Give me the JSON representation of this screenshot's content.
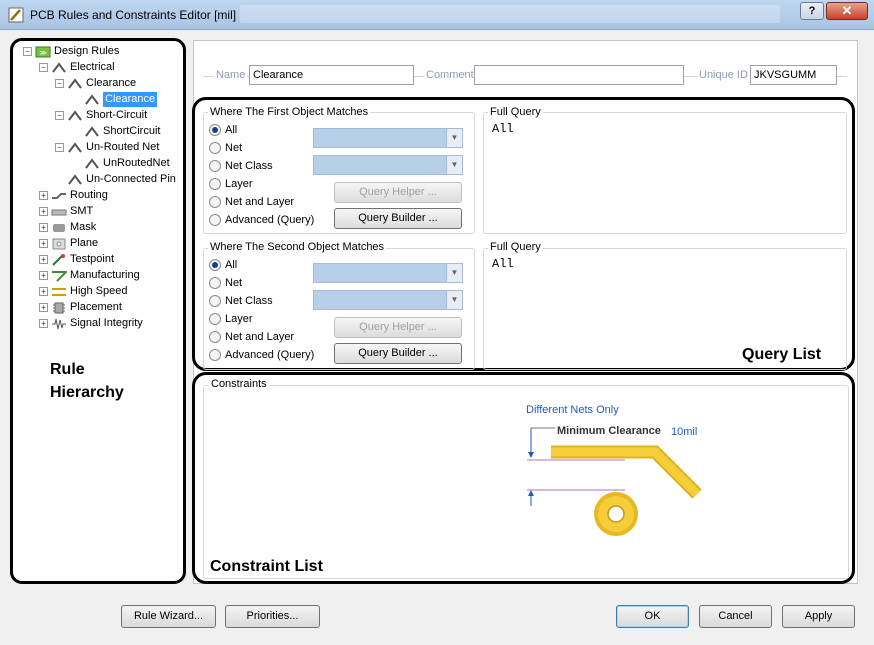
{
  "window": {
    "title": "PCB Rules and Constraints Editor [mil]",
    "help_label": "?",
    "close_label": "✕"
  },
  "tree": {
    "items": [
      {
        "label": "Design Rules"
      },
      {
        "label": "Electrical"
      },
      {
        "label": "Clearance"
      },
      {
        "label": "Clearance"
      },
      {
        "label": "Short-Circuit"
      },
      {
        "label": "ShortCircuit"
      },
      {
        "label": "Un-Routed Net"
      },
      {
        "label": "UnRoutedNet"
      },
      {
        "label": "Un-Connected Pin"
      },
      {
        "label": "Routing"
      },
      {
        "label": "SMT"
      },
      {
        "label": "Mask"
      },
      {
        "label": "Plane"
      },
      {
        "label": "Testpoint"
      },
      {
        "label": "Manufacturing"
      },
      {
        "label": "High Speed"
      },
      {
        "label": "Placement"
      },
      {
        "label": "Signal Integrity"
      }
    ],
    "annotation_line1": "Rule",
    "annotation_line2": "Hierarchy"
  },
  "rule": {
    "name_label": "Name",
    "name_value": "Clearance",
    "comment_label": "Comment",
    "comment_value": "",
    "uid_label": "Unique ID",
    "uid_value": "JKVSGUMM"
  },
  "first_match": {
    "title": "Where The First Object Matches",
    "options": [
      "All",
      "Net",
      "Net Class",
      "Layer",
      "Net and Layer",
      "Advanced (Query)"
    ],
    "query_helper": "Query Helper ...",
    "query_builder": "Query Builder ...",
    "full_query_title": "Full Query",
    "full_query": "All"
  },
  "second_match": {
    "title": "Where The Second Object Matches",
    "options": [
      "All",
      "Net",
      "Net Class",
      "Layer",
      "Net and Layer",
      "Advanced (Query)"
    ],
    "query_helper": "Query Helper ...",
    "query_builder": "Query Builder ...",
    "full_query_title": "Full Query",
    "full_query": "All"
  },
  "query_annotation": "Query List",
  "constraints": {
    "title": "Constraints",
    "net_scope": "Different Nets Only",
    "min_clearance_label": "Minimum Clearance",
    "min_clearance_value": "10mil",
    "annotation": "Constraint List"
  },
  "buttons": {
    "rule_wizard": "Rule Wizard...",
    "priorities": "Priorities...",
    "ok": "OK",
    "cancel": "Cancel",
    "apply": "Apply"
  },
  "colors": {
    "accent_selection": "#3399ff",
    "track_gold": "#f1c232",
    "link_blue": "#1e5bbf"
  }
}
